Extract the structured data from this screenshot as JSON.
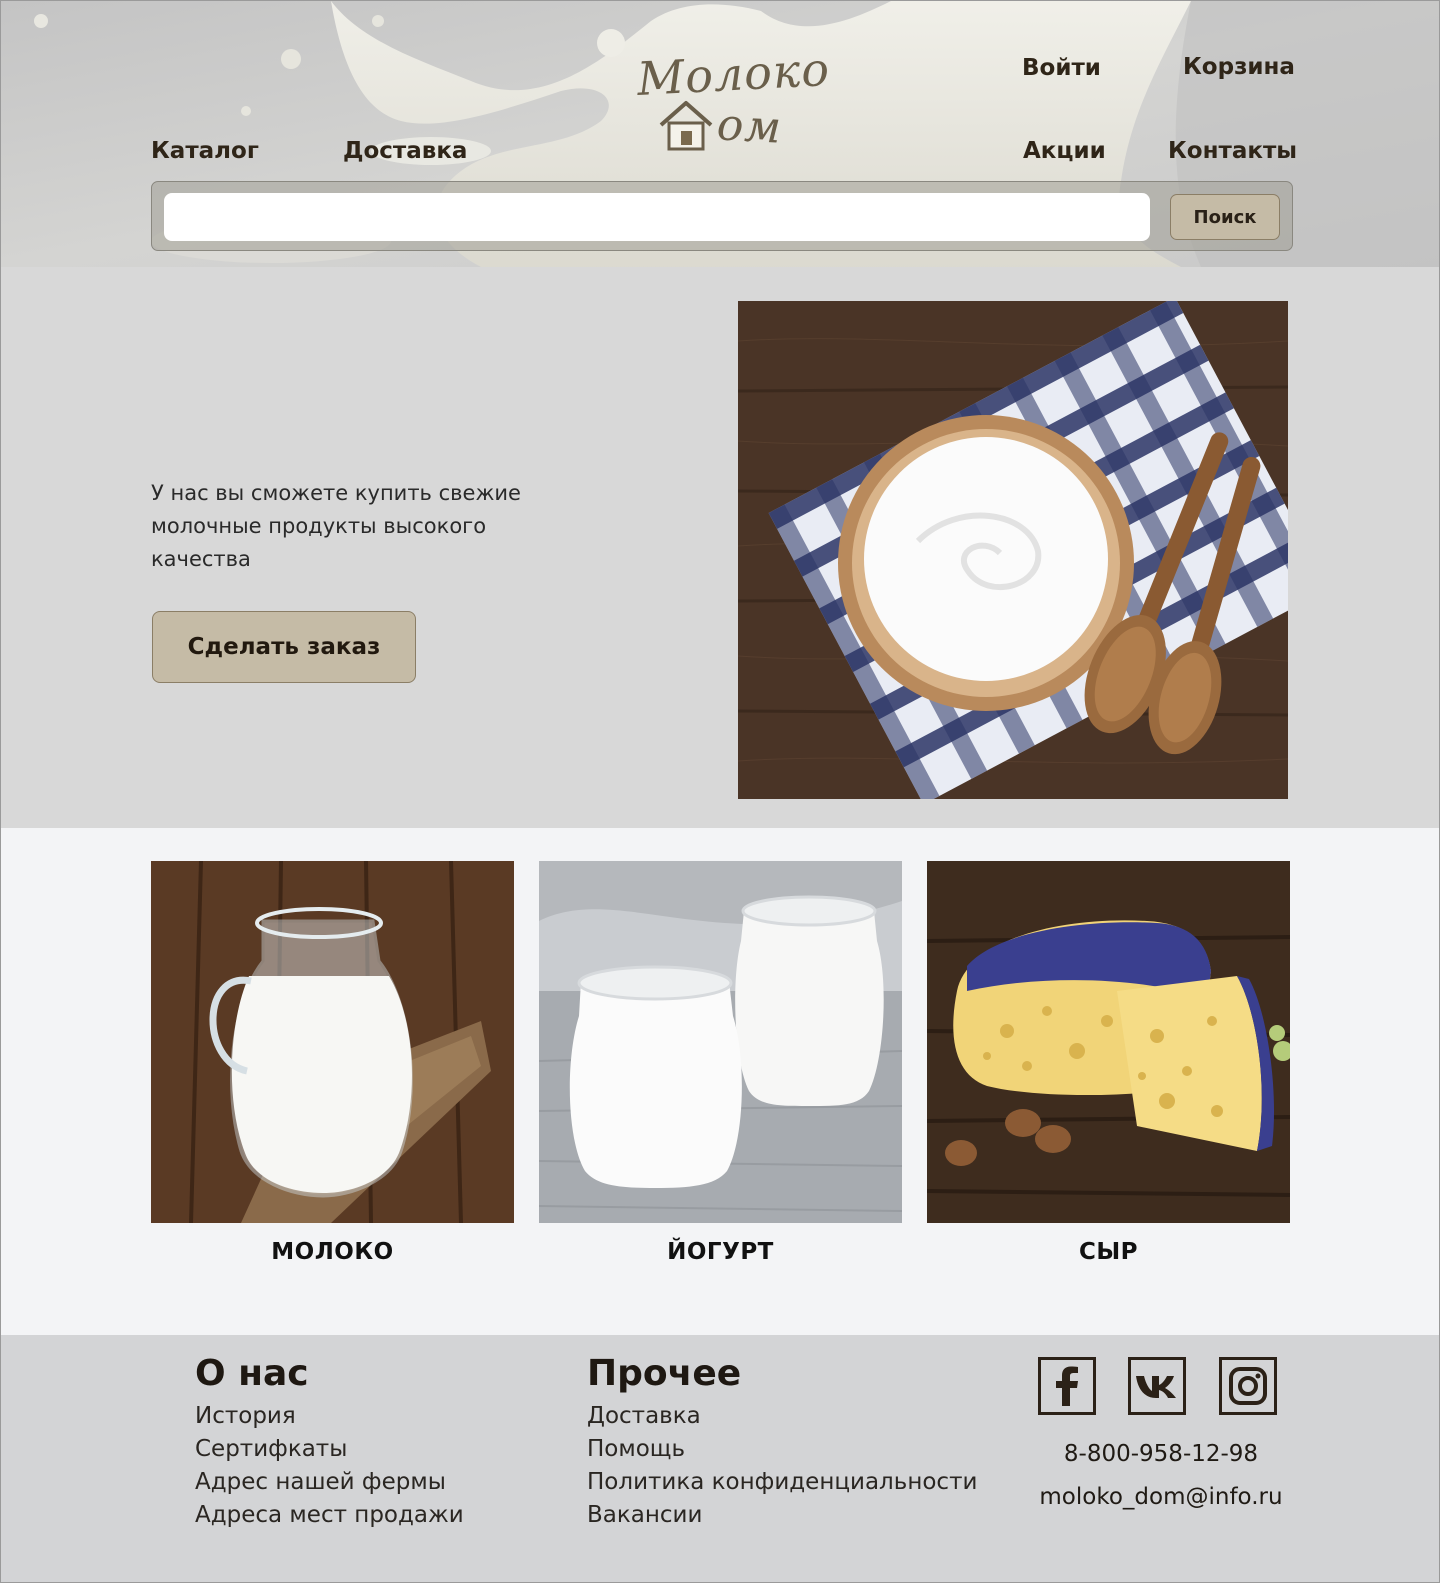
{
  "header": {
    "logo": {
      "line1": "Молоко",
      "line2": "ом"
    },
    "nav": {
      "login": "Войти",
      "cart": "Корзина",
      "catalog": "Каталог",
      "delivery": "Доставка",
      "promotions": "Акции",
      "contacts": "Контакты"
    },
    "search": {
      "value": "",
      "button_label": "Поиск"
    }
  },
  "hero": {
    "text": "У нас вы сможете купить свежие молочные продукты высокого качества",
    "order_button": "Сделать заказ"
  },
  "products": [
    {
      "label": "МОЛОКО",
      "image": "milk-jug-photo"
    },
    {
      "label": "ЙОГУРТ",
      "image": "yogurt-jars-photo"
    },
    {
      "label": "СЫР",
      "image": "cheese-wheel-photo"
    }
  ],
  "footer": {
    "about": {
      "heading": "О нас",
      "links": [
        "История",
        "Сертифкаты",
        "Адрес нашей фермы",
        "Адреса мест продажи"
      ]
    },
    "other": {
      "heading": "Прочее",
      "links": [
        "Доставка",
        "Помощь",
        "Политика конфиденциальности",
        "Вакансии"
      ]
    },
    "social": [
      "facebook-icon",
      "vk-icon",
      "instagram-icon"
    ],
    "phone": "8-800-958-12-98",
    "email": "moloko_dom@info.ru"
  },
  "colors": {
    "accent_button": "#c5bba6",
    "hero_bg": "#d8d8d8",
    "products_bg": "#f3f4f6",
    "footer_bg": "#d3d4d6",
    "text_dark": "#2f2518"
  }
}
